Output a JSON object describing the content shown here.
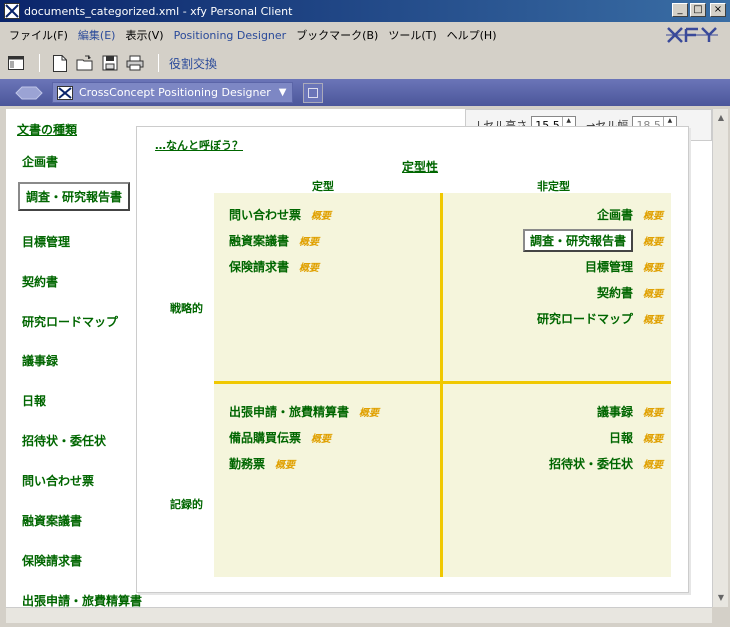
{
  "window": {
    "title": "documents_categorized.xml - xfy Personal Client",
    "minimize": "_",
    "maximize": "□",
    "close": "×"
  },
  "menu": {
    "items": [
      {
        "label": "ファイル(F)"
      },
      {
        "label": "編集(E)"
      },
      {
        "label": "表示(V)"
      },
      {
        "label": "Positioning Designer"
      },
      {
        "label": "ブックマーク(B)"
      },
      {
        "label": "ツール(T)"
      },
      {
        "label": "ヘルプ(H)"
      }
    ]
  },
  "toolbar": {
    "role_swap": "役割交換"
  },
  "designer": {
    "concept": "CrossConcept Positioning Designer",
    "dropdown": "▼"
  },
  "cell_controls": {
    "height_label": "↓セル高さ",
    "height_value": "15.5",
    "width_label": "→セル幅",
    "width_value": "18.5"
  },
  "sidebar": {
    "heading": "文書の種類",
    "items": [
      "企画書",
      "調査・研究報告書",
      "目標管理",
      "契約書",
      "研究ロードマップ",
      "議事録",
      "日報",
      "招待状・委任状",
      "問い合わせ票",
      "融資案議書",
      "保険請求書",
      "出張申請・旅費精算書"
    ]
  },
  "chart": {
    "title": "…なんと呼ぼう？",
    "x_title": "定型性",
    "x_left": "定型",
    "x_right": "非定型",
    "y_top": "戦略的",
    "y_bottom": "記録的",
    "summary": "概要",
    "quadrants": {
      "top_left": [
        "問い合わせ票",
        "融資案議書",
        "保険請求書"
      ],
      "top_right": [
        "企画書",
        "調査・研究報告書",
        "目標管理",
        "契約書",
        "研究ロードマップ"
      ],
      "bottom_left": [
        "出張申請・旅費精算書",
        "備品購買伝票",
        "勤務票"
      ],
      "bottom_right": [
        "議事録",
        "日報",
        "招待状・委任状"
      ]
    }
  },
  "scroll": {
    "up": "▲",
    "down": "▼"
  }
}
